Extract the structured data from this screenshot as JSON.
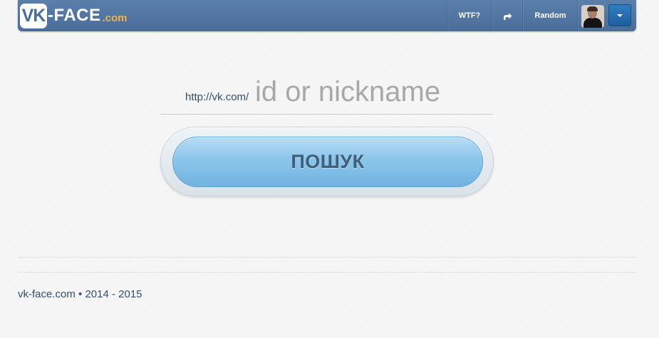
{
  "header": {
    "logo": {
      "vk": "VK",
      "face": "-FACE",
      "com": ".com"
    },
    "nav": {
      "wtf_label": "WTF?",
      "share_icon": "share-icon",
      "random_label": "Random"
    },
    "user": {
      "avatar_icon": "avatar",
      "menu_icon": "caret-down-icon"
    },
    "colors": {
      "navbar": "#4f739f",
      "logo_accent": "#f0b24d",
      "dropdown_button": "#2570b3"
    }
  },
  "search": {
    "url_prefix": "http://vk.com/",
    "placeholder": "id or nickname",
    "value": "",
    "button_label": "ПОШУК",
    "button_color": "#8cc5eb"
  },
  "footer": {
    "text": "vk-face.com • 2014 - 2015"
  }
}
